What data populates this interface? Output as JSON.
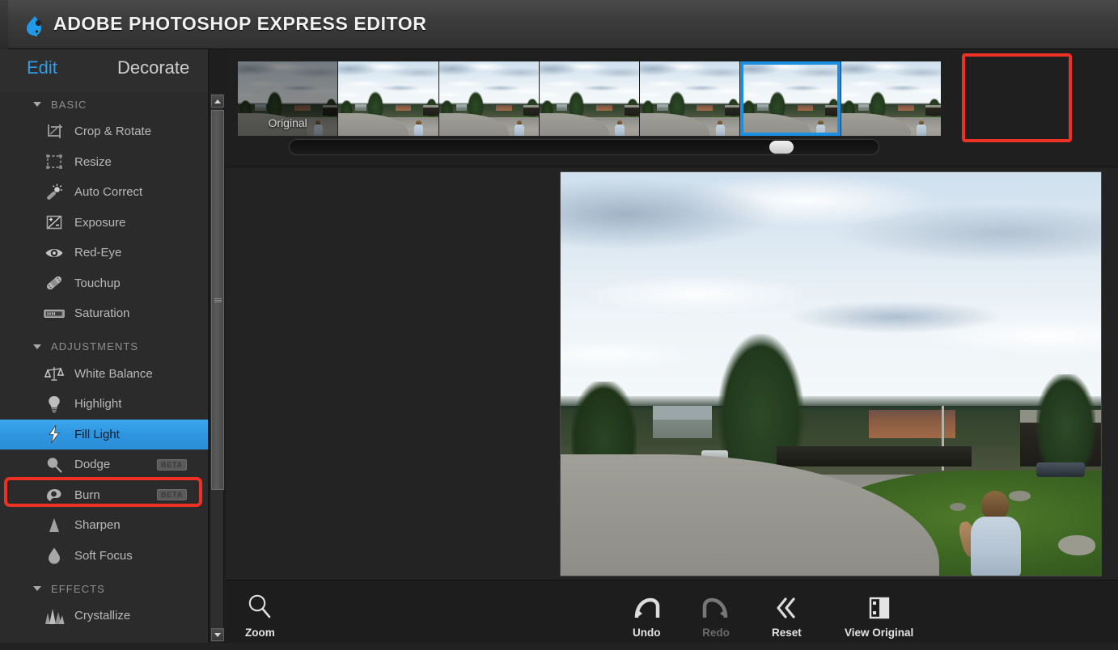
{
  "window": {
    "title": "ADOBE PHOTOSHOP EXPRESS EDITOR",
    "logo_icon": "photoshop-express-drop-icon"
  },
  "sidebar": {
    "tabs": [
      {
        "label": "Edit",
        "active": true
      },
      {
        "label": "Decorate",
        "active": false
      }
    ],
    "groups": [
      {
        "label": "BASIC",
        "expanded": true,
        "items": [
          {
            "label": "Crop & Rotate",
            "icon": "crop-rotate-icon",
            "selected": false,
            "badge": ""
          },
          {
            "label": "Resize",
            "icon": "resize-icon",
            "selected": false,
            "badge": ""
          },
          {
            "label": "Auto Correct",
            "icon": "magic-wand-icon",
            "selected": false,
            "badge": ""
          },
          {
            "label": "Exposure",
            "icon": "exposure-icon",
            "selected": false,
            "badge": ""
          },
          {
            "label": "Red-Eye",
            "icon": "eye-icon",
            "selected": false,
            "badge": ""
          },
          {
            "label": "Touchup",
            "icon": "bandage-icon",
            "selected": false,
            "badge": ""
          },
          {
            "label": "Saturation",
            "icon": "saturation-slider-icon",
            "selected": false,
            "badge": ""
          }
        ]
      },
      {
        "label": "ADJUSTMENTS",
        "expanded": true,
        "items": [
          {
            "label": "White Balance",
            "icon": "balance-scale-icon",
            "selected": false,
            "badge": ""
          },
          {
            "label": "Highlight",
            "icon": "lightbulb-icon",
            "selected": false,
            "badge": ""
          },
          {
            "label": "Fill Light",
            "icon": "lightning-bolt-icon",
            "selected": true,
            "badge": ""
          },
          {
            "label": "Dodge",
            "icon": "dodge-circle-icon",
            "selected": false,
            "badge": "BETA"
          },
          {
            "label": "Burn",
            "icon": "burn-hand-icon",
            "selected": false,
            "badge": "BETA"
          },
          {
            "label": "Sharpen",
            "icon": "sharpen-triangle-icon",
            "selected": false,
            "badge": ""
          },
          {
            "label": "Soft Focus",
            "icon": "soft-focus-drop-icon",
            "selected": false,
            "badge": ""
          }
        ]
      },
      {
        "label": "EFFECTS",
        "expanded": true,
        "items": [
          {
            "label": "Crystallize",
            "icon": "crystallize-icon",
            "selected": false,
            "badge": ""
          }
        ]
      }
    ],
    "scrollbar": {
      "up_icon": "scroll-up-arrow-icon",
      "down_icon": "scroll-down-arrow-icon"
    }
  },
  "filmstrip": {
    "thumbnails": [
      {
        "label": "Original",
        "selected": false,
        "is_original": true
      },
      {
        "label": "",
        "selected": false,
        "is_original": false
      },
      {
        "label": "",
        "selected": false,
        "is_original": false
      },
      {
        "label": "",
        "selected": false,
        "is_original": false
      },
      {
        "label": "",
        "selected": false,
        "is_original": false
      },
      {
        "label": "",
        "selected": true,
        "is_original": false
      },
      {
        "label": "",
        "selected": false,
        "is_original": false
      }
    ],
    "slider": {
      "value_percent": 84
    }
  },
  "toolbar": {
    "items": [
      {
        "label": "Zoom",
        "icon": "magnifier-icon",
        "disabled": false
      },
      {
        "label": "Undo",
        "icon": "undo-arrow-icon",
        "disabled": false
      },
      {
        "label": "Redo",
        "icon": "redo-arrow-icon",
        "disabled": true
      },
      {
        "label": "Reset",
        "icon": "double-chevron-left-icon",
        "disabled": false
      },
      {
        "label": "View Original",
        "icon": "split-compare-icon",
        "disabled": false
      }
    ]
  },
  "annotations": {
    "fill_light_highlight_color": "#ed3124",
    "thumbnail_highlight_color": "#ed3124",
    "selection_color": "#1b8fe0",
    "accent_color": "#2f9ce8"
  },
  "status_bar": {
    "text": ""
  }
}
